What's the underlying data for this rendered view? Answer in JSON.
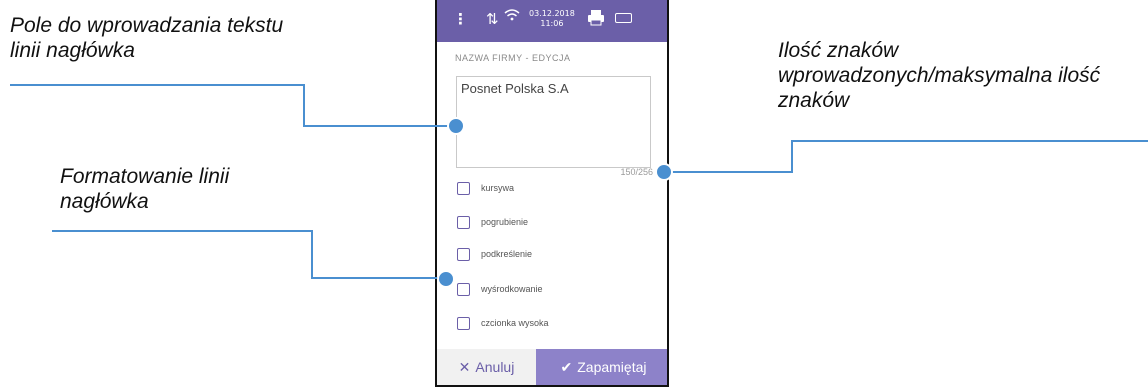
{
  "callouts": {
    "text_field": "Pole do wprowadzania tekstu linii nagłówka",
    "formatting": "Formatowanie linii nagłówka",
    "char_count": "Ilość znaków wprowadzonych/maksymalna ilość znaków"
  },
  "status_bar": {
    "date": "03.12.2018",
    "time": "11:06",
    "menu_icon": "kebab-menu-icon",
    "data_icon": "data-transfer-icon",
    "wifi_icon": "wifi-icon",
    "printer_icon": "printer-icon",
    "battery_icon": "battery-icon"
  },
  "form": {
    "title": "NAZWA FIRMY - EDYCJA",
    "text_value": "Posnet Polska S.A",
    "counter": "150/256",
    "options": [
      {
        "label": "kursywa",
        "checked": false
      },
      {
        "label": "pogrubienie",
        "checked": false
      },
      {
        "label": "podkreślenie",
        "checked": false
      },
      {
        "label": "wyśrodkowanie",
        "checked": false
      },
      {
        "label": "czcionka wysoka",
        "checked": false
      }
    ]
  },
  "buttons": {
    "cancel_label": "Anuluj",
    "cancel_icon": "close-icon",
    "save_label": "Zapamiętaj",
    "save_icon": "checkmark-icon"
  },
  "colors": {
    "accent": "#6b5fa8",
    "save_button": "#8d82c9",
    "leader_line": "#4a8fd0"
  }
}
